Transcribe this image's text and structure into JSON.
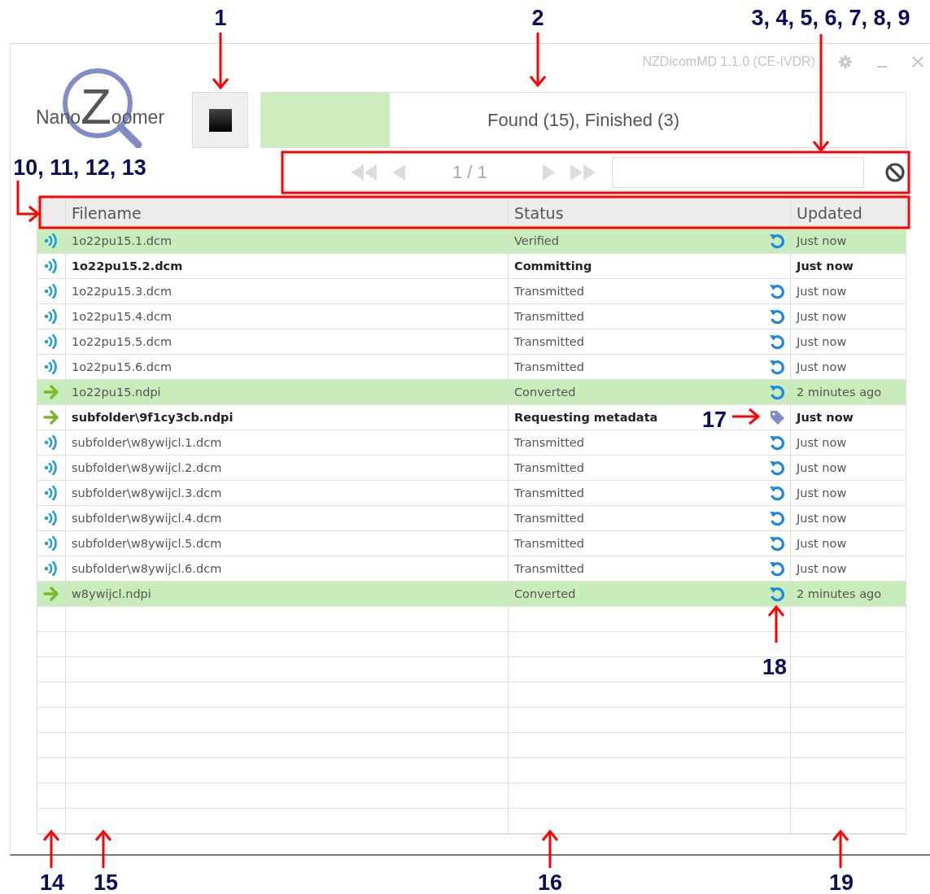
{
  "window": {
    "title": "NZDicomMD 1.1.0 (CE-IVDR)"
  },
  "logo": {
    "text": "Nano",
    "initial": "Z",
    "rest": "oomer"
  },
  "progress": {
    "level": 0.2,
    "text": "Found (15), Finished (3)"
  },
  "pager": {
    "items": [
      {
        "kind": "first",
        "disabled": true
      },
      {
        "kind": "prev",
        "disabled": true
      },
      {
        "kind": "page",
        "text": "1 / 1",
        "disabled": true
      },
      {
        "kind": "next",
        "disabled": true
      },
      {
        "kind": "last",
        "disabled": true
      }
    ]
  },
  "table": {
    "columns": [
      "Filename",
      "Status",
      "Updated"
    ],
    "rows": [
      {
        "kind": "dcm",
        "filename": "1o22pu15.1.dcm",
        "status": "Verified",
        "retry": true,
        "tagged": false,
        "updated": "Just now",
        "finished": true,
        "in_progress": false
      },
      {
        "kind": "dcm",
        "filename": "1o22pu15.2.dcm",
        "status": "Committing",
        "retry": false,
        "tagged": false,
        "updated": "Just now",
        "finished": false,
        "in_progress": true
      },
      {
        "kind": "dcm",
        "filename": "1o22pu15.3.dcm",
        "status": "Transmitted",
        "retry": true,
        "tagged": false,
        "updated": "Just now",
        "finished": false,
        "in_progress": false
      },
      {
        "kind": "dcm",
        "filename": "1o22pu15.4.dcm",
        "status": "Transmitted",
        "retry": true,
        "tagged": false,
        "updated": "Just now",
        "finished": false,
        "in_progress": false
      },
      {
        "kind": "dcm",
        "filename": "1o22pu15.5.dcm",
        "status": "Transmitted",
        "retry": true,
        "tagged": false,
        "updated": "Just now",
        "finished": false,
        "in_progress": false
      },
      {
        "kind": "dcm",
        "filename": "1o22pu15.6.dcm",
        "status": "Transmitted",
        "retry": true,
        "tagged": false,
        "updated": "Just now",
        "finished": false,
        "in_progress": false
      },
      {
        "kind": "ndpi",
        "filename": "1o22pu15.ndpi",
        "status": "Converted",
        "retry": true,
        "tagged": false,
        "updated": "2 minutes ago",
        "finished": true,
        "in_progress": false
      },
      {
        "kind": "ndpi",
        "filename": "subfolder\\9f1cy3cb.ndpi",
        "status": "Requesting metadata",
        "retry": false,
        "tagged": true,
        "updated": "Just now",
        "finished": false,
        "in_progress": true
      },
      {
        "kind": "dcm",
        "filename": "subfolder\\w8ywijcl.1.dcm",
        "status": "Transmitted",
        "retry": true,
        "tagged": false,
        "updated": "Just now",
        "finished": false,
        "in_progress": false
      },
      {
        "kind": "dcm",
        "filename": "subfolder\\w8ywijcl.2.dcm",
        "status": "Transmitted",
        "retry": true,
        "tagged": false,
        "updated": "Just now",
        "finished": false,
        "in_progress": false
      },
      {
        "kind": "dcm",
        "filename": "subfolder\\w8ywijcl.3.dcm",
        "status": "Transmitted",
        "retry": true,
        "tagged": false,
        "updated": "Just now",
        "finished": false,
        "in_progress": false
      },
      {
        "kind": "dcm",
        "filename": "subfolder\\w8ywijcl.4.dcm",
        "status": "Transmitted",
        "retry": true,
        "tagged": false,
        "updated": "Just now",
        "finished": false,
        "in_progress": false
      },
      {
        "kind": "dcm",
        "filename": "subfolder\\w8ywijcl.5.dcm",
        "status": "Transmitted",
        "retry": true,
        "tagged": false,
        "updated": "Just now",
        "finished": false,
        "in_progress": false
      },
      {
        "kind": "dcm",
        "filename": "subfolder\\w8ywijcl.6.dcm",
        "status": "Transmitted",
        "retry": true,
        "tagged": false,
        "updated": "Just now",
        "finished": false,
        "in_progress": false
      },
      {
        "kind": "ndpi",
        "filename": "w8ywijcl.ndpi",
        "status": "Converted",
        "retry": true,
        "tagged": false,
        "updated": "2 minutes ago",
        "finished": true,
        "in_progress": false
      }
    ]
  },
  "annotations": [
    {
      "label": "1"
    },
    {
      "label": "2"
    },
    {
      "label": "3, 4, 5, 6, 7, 8, 9"
    },
    {
      "label": "10, 11, 12, 13"
    },
    {
      "label": "17"
    },
    {
      "label": "18"
    },
    {
      "label": "14"
    },
    {
      "label": "15"
    },
    {
      "label": "16"
    },
    {
      "label": "19"
    }
  ]
}
